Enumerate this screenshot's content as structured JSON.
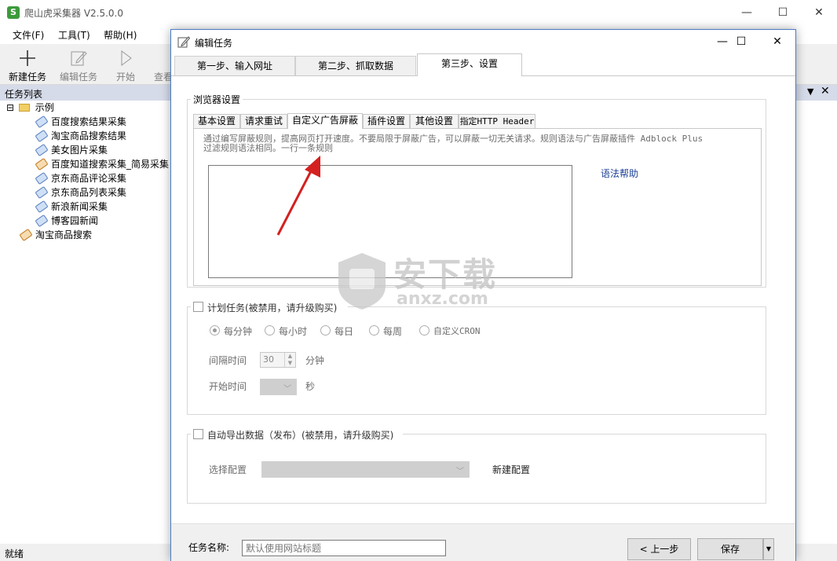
{
  "app": {
    "title": "爬山虎采集器 V2.5.0.0",
    "menu": [
      "文件(F)",
      "工具(T)",
      "帮助(H)"
    ],
    "toolbar": [
      "新建任务",
      "编辑任务",
      "开始",
      "查看"
    ],
    "tasklist_title": "任务列表",
    "status": "就绪"
  },
  "tree": {
    "root": "示例",
    "expander": "⊟",
    "children": [
      "百度搜索结果采集",
      "淘宝商品搜索结果",
      "美女图片采集",
      "百度知道搜索采集_简易采集",
      "京东商品评论采集",
      "京东商品列表采集",
      "新浪新闻采集",
      "博客园新闻"
    ],
    "extra": "淘宝商品搜索"
  },
  "dialog": {
    "title": "编辑任务",
    "steps": [
      "第一步、输入网址",
      "第二步、抓取数据",
      "第三步、设置"
    ],
    "active_step": 2,
    "browser_settings": {
      "title": "浏览器设置",
      "tabs": [
        "基本设置",
        "请求重试",
        "自定义广告屏蔽",
        "插件设置",
        "其他设置",
        "指定HTTP Header"
      ],
      "active_tab": 2,
      "description_line1": "通过编写屏蔽规则，提高网页打开速度。不要局限于屏蔽广告，可以屏蔽一切无关请求。规则语法与广告屏蔽插件 Adblock Plus",
      "description_line2": "过滤规则语法相同。一行一条规则",
      "rules_value": "",
      "syntax_help": "语法帮助"
    },
    "schedule": {
      "title": "计划任务(被禁用，请升级购买)",
      "options": [
        "每分钟",
        "每小时",
        "每日",
        "每周",
        "自定义CRON"
      ],
      "selected": 0,
      "interval_label": "间隔时间",
      "interval_value": "30",
      "interval_unit": "分钟",
      "start_label": "开始时间",
      "start_unit": "秒"
    },
    "export": {
      "title": "自动导出数据（发布）(被禁用，请升级购买)",
      "config_label": "选择配置",
      "new_config": "新建配置"
    },
    "footer": {
      "task_name_label": "任务名称:",
      "task_name_placeholder": "默认使用网站标题",
      "prev_button": "< 上一步",
      "save_button": "保存"
    }
  },
  "watermark": {
    "text_cn": "安下载",
    "text_en": "anxz.com"
  },
  "colors": {
    "accent_border": "#4a7ec4",
    "link": "#1c3f94",
    "arrow": "#d42020",
    "tasklist_header": "#d6dbe9"
  }
}
